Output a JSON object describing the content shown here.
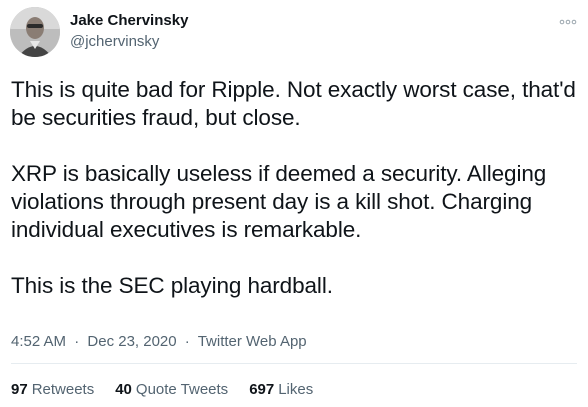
{
  "author": {
    "display_name": "Jake Chervinsky",
    "handle": "@jchervinsky"
  },
  "tweet": {
    "paragraphs": [
      "This is quite bad for Ripple. Not exactly worst case, that'd be securities fraud, but close.",
      "XRP is basically useless if deemed a security. Alleging violations through present day is a kill shot. Charging individual executives is remarkable.",
      "This is the SEC playing hardball."
    ],
    "time": "4:52 AM",
    "date": "Dec 23, 2020",
    "source": "Twitter Web App",
    "separator": "·"
  },
  "stats": {
    "retweets_count": "97",
    "retweets_label": "Retweets",
    "quotes_count": "40",
    "quotes_label": "Quote Tweets",
    "likes_count": "697",
    "likes_label": "Likes"
  },
  "icons": {
    "more": "more-options-icon"
  },
  "colors": {
    "text_primary": "#0f1419",
    "text_secondary": "#536471",
    "divider": "#e6ecf0"
  }
}
